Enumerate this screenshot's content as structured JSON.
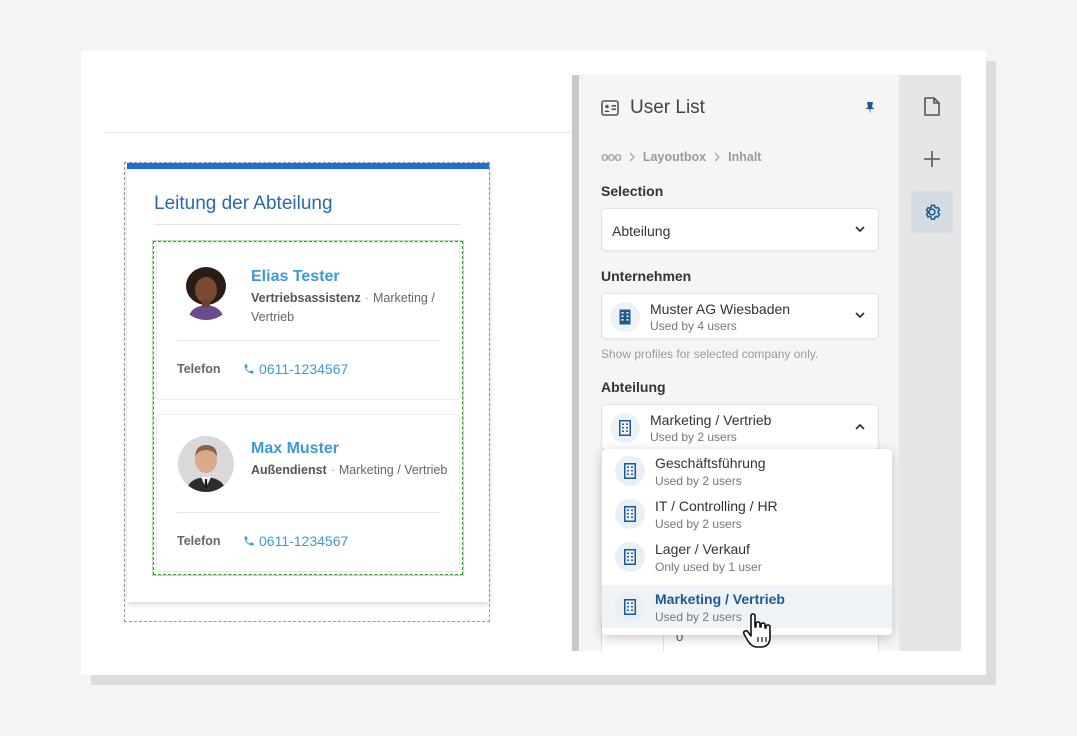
{
  "widget": {
    "title": "Leitung der Abteilung",
    "users": [
      {
        "name": "Elias Tester",
        "role": "Vertriebsassistenz",
        "separator": "·",
        "department_a": "Marketing",
        "department_b": "/ Vertrieb",
        "phone_label": "Telefon",
        "phone": "0611-1234567"
      },
      {
        "name": "Max Muster",
        "role": "Außendienst",
        "separator": "·",
        "department_a": "Marketing /",
        "department_b": "Vertrieb",
        "phone_label": "Telefon",
        "phone": "0611-1234567"
      }
    ]
  },
  "panel": {
    "title": "User List",
    "breadcrumb": {
      "more": "ooo",
      "items": [
        "Layoutbox",
        "Inhalt"
      ]
    },
    "selection": {
      "label": "Selection",
      "value": "Abteilung"
    },
    "company": {
      "label": "Unternehmen",
      "value": "Muster AG Wiesbaden",
      "sub": "Used by 4 users",
      "hint": "Show profiles for selected company only."
    },
    "department": {
      "label": "Abteilung",
      "value": "Marketing / Vertrieb",
      "sub": "Used by 2 users"
    },
    "hidden_field": {
      "value": "0"
    }
  },
  "dropdown": {
    "options": [
      {
        "label": "Geschäftsführung",
        "sub": "Used by 2 users",
        "selected": false
      },
      {
        "label": "IT / Controlling / HR",
        "sub": "Used by 2 users",
        "selected": false
      },
      {
        "label": "Lager / Verkauf",
        "sub": "Only used by 1 user",
        "selected": false
      },
      {
        "label": "Marketing / Vertrieb",
        "sub": "Used by 2 users",
        "selected": true
      }
    ]
  },
  "rail": {
    "icons": [
      "page-icon",
      "plus-icon",
      "gear-icon"
    ],
    "active": "gear-icon"
  },
  "colors": {
    "accent": "#1d6fd1",
    "link": "#3d9ad6",
    "title": "#2a68b0",
    "selected_text": "#1d5a94"
  }
}
